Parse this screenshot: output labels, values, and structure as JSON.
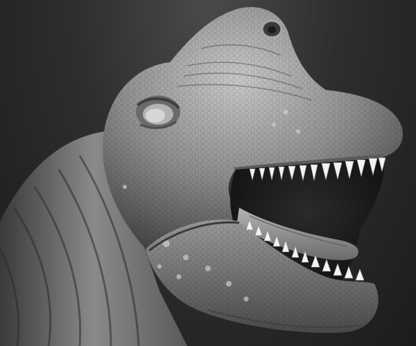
{
  "scene": {
    "subject_icon": "dinosaur-head-sculpt-icon",
    "colors": {
      "background_top": "#4a4a4a",
      "background_bottom": "#1c1c1c",
      "clay_light": "#c9c9c9",
      "clay_mid": "#8e8e8e",
      "clay_dark": "#3c3c3c",
      "mouth_interior": "#141414",
      "teeth": "#f2f2f2"
    }
  }
}
